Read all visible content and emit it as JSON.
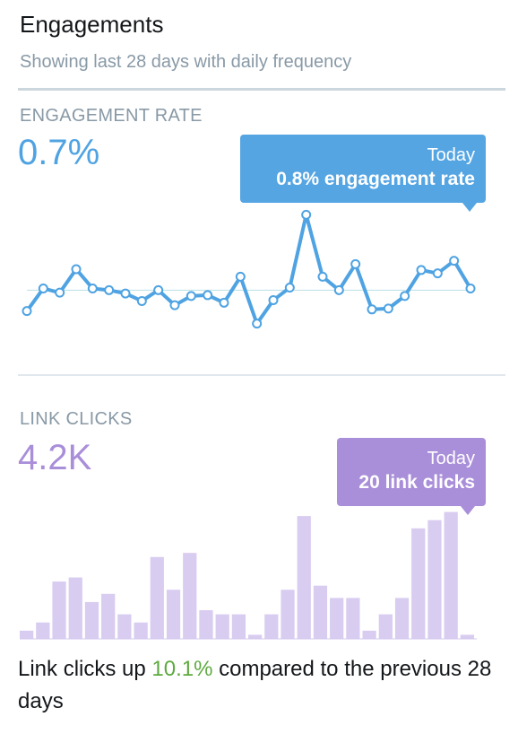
{
  "header": {
    "title": "Engagements",
    "subtitle": "Showing last 28 days with daily frequency"
  },
  "engagement_rate": {
    "label": "ENGAGEMENT RATE",
    "value": "0.7%",
    "tooltip_day": "Today",
    "tooltip_text": "0.8% engagement rate",
    "color": "#4fa3e2"
  },
  "link_clicks": {
    "label": "LINK CLICKS",
    "value": "4.2K",
    "tooltip_day": "Today",
    "tooltip_text": "20 link clicks",
    "color": "#a98ed9",
    "bar_color": "#d8ccf0"
  },
  "footer": {
    "prefix": "Link clicks up ",
    "percent": "10.1%",
    "suffix": " compared to the previous 28 days",
    "percent_color": "#5daa3f"
  },
  "chart_data": [
    {
      "type": "line",
      "series": [
        {
          "values": [
            0.45,
            0.72,
            0.67,
            0.95,
            0.72,
            0.7,
            0.66,
            0.57,
            0.7,
            0.52,
            0.63,
            0.64,
            0.55,
            0.86,
            0.3,
            0.58,
            0.73,
            1.6,
            0.86,
            0.7,
            1.01,
            0.47,
            0.48,
            0.63,
            0.94,
            0.9,
            1.05,
            0.72
          ]
        }
      ],
      "baseline": 0.7,
      "ylim": [
        0.2,
        1.7
      ]
    },
    {
      "type": "bar",
      "series": [
        {
          "values": [
            2,
            4,
            14,
            15,
            9,
            11,
            6,
            4,
            20,
            12,
            21,
            7,
            6,
            6,
            1,
            6,
            12,
            30,
            13,
            10,
            10,
            2,
            6,
            10,
            27,
            29,
            31,
            1
          ]
        }
      ],
      "ylim": [
        0,
        32
      ]
    }
  ]
}
